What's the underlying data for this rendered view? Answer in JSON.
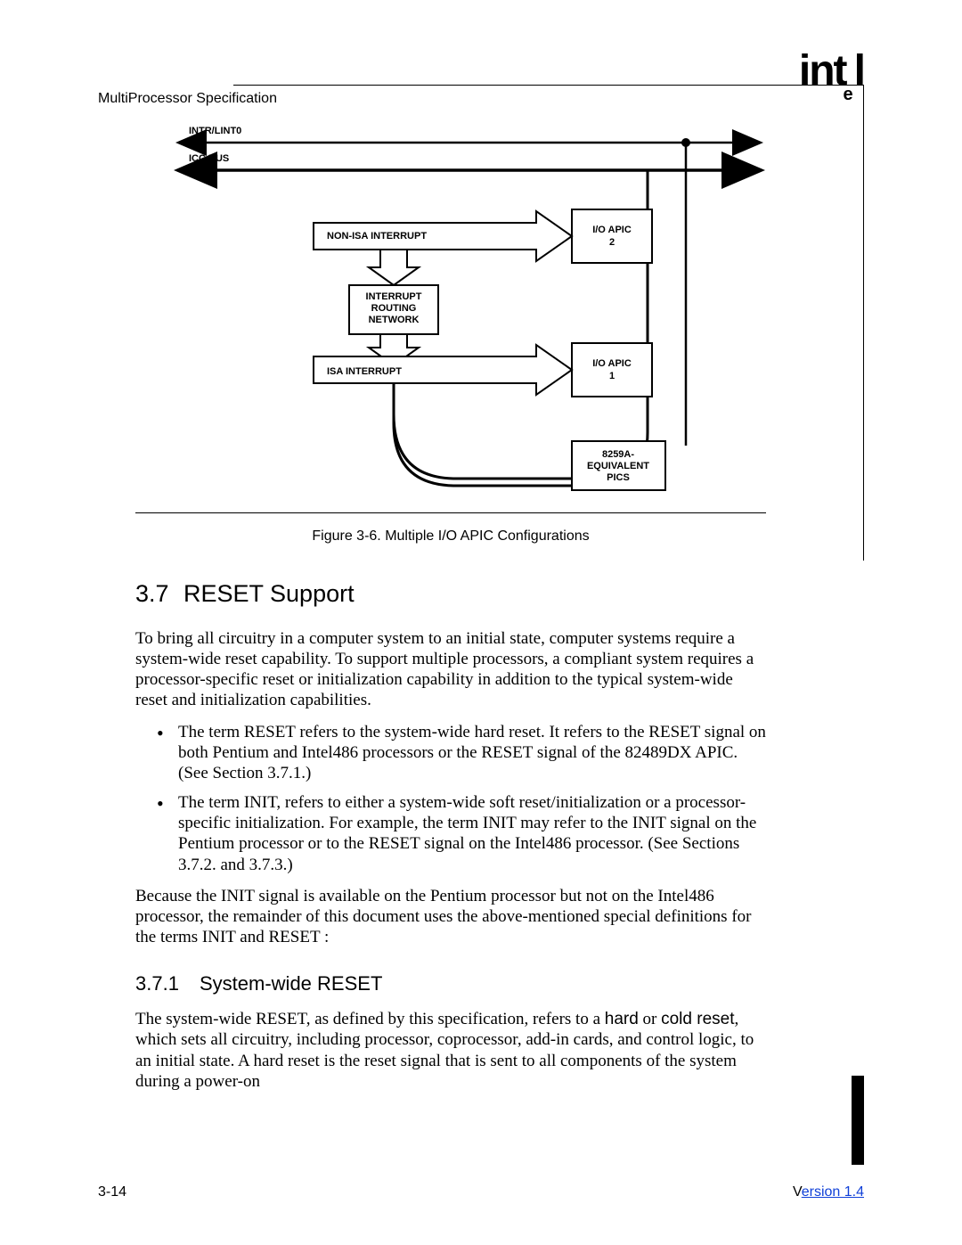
{
  "header": {
    "doc_title": "MultiProcessor Specification",
    "logo_text": "intel"
  },
  "figure": {
    "caption": "Figure 3-6.  Multiple I/O APIC Configurations",
    "labels": {
      "intr": "INTR/LINT0",
      "icc": "ICC BUS",
      "non_isa": "NON-ISA INTERRUPT",
      "isa": "ISA INTERRUPT",
      "irn1": "INTERRUPT",
      "irn2": "ROUTING",
      "irn3": "NETWORK",
      "apic2a": "I/O APIC",
      "apic2b": "2",
      "apic1a": "I/O APIC",
      "apic1b": "1",
      "pics1": "8259A-",
      "pics2": "EQUIVALENT",
      "pics3": "PICS"
    }
  },
  "section": {
    "num": "3.7",
    "title": "RESET Support",
    "para1": "To bring all circuitry in a computer system to an initial state, computer systems require a system-wide reset capability.  To support multiple processors, a compliant system requires a processor-specific reset or initialization capability in addition to the typical system-wide reset and initialization capabilities.",
    "bullet1": "The term  RESET  refers to the system-wide hard reset.  It refers to the RESET signal on both Pentium and Intel486 processors or the RESET signal of the 82489DX APIC.  (See Section 3.7.1.)",
    "bullet2": "The term  INIT,  refers to either a system-wide soft reset/initialization or a processor-specific initialization.  For example, the term  INIT  may refer to the INIT signal on the Pentium processor or to the RESET signal on the Intel486 processor.  (See Sections 3.7.2. and 3.7.3.)",
    "para2": "Because the INIT signal is available on the Pentium processor but not on the Intel486 processor, the remainder of this document uses the above-mentioned special definitions for the terms  INIT and  RESET :"
  },
  "subsection": {
    "num": "3.7.1",
    "title": "System-wide RESET",
    "para_a": "The system-wide RESET, as defined by this specification, refers to a ",
    "hard": "hard",
    "or": " or ",
    "cold": "cold reset",
    "para_b": ", which sets all circuitry, including processor, coprocessor, add-in cards, and control logic, to an initial state.  A hard reset is the reset signal that is sent to all components of the system during a power-on"
  },
  "footer": {
    "page": "3-14",
    "version_v": "V",
    "version_rest": "ersion 1.4"
  }
}
